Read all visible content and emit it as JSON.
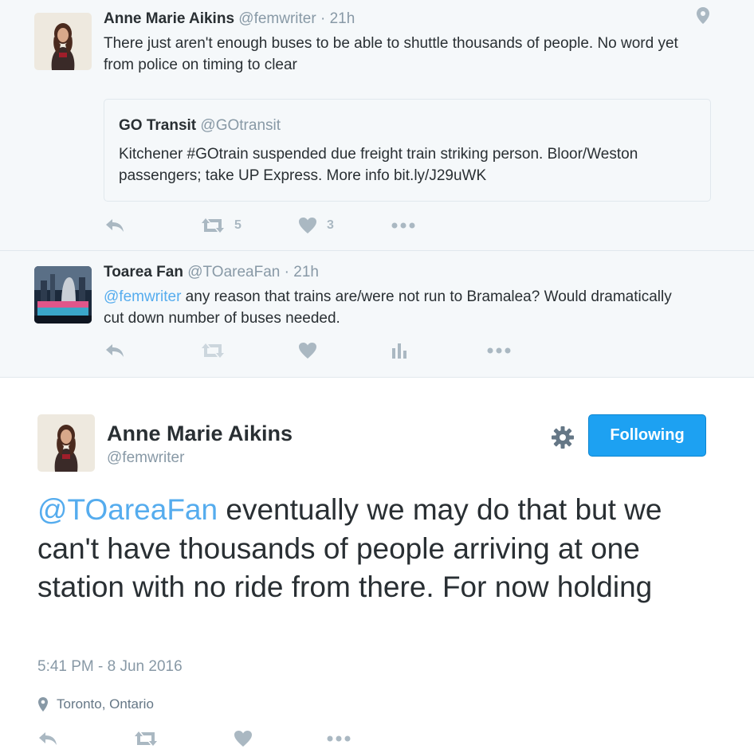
{
  "tweet1": {
    "name": "Anne Marie Aikins",
    "handle": "@femwriter",
    "time": "· 21h",
    "text": "There just aren't enough buses to be able to shuttle thousands of people. No word yet from police on timing to clear",
    "quote": {
      "name": "GO Transit",
      "handle": "@GOtransit",
      "text": "Kitchener #GOtrain suspended due freight train striking person. Bloor/Weston passengers; take UP Express. More info bit.ly/J29uWK"
    },
    "retweets": "5",
    "likes": "3"
  },
  "tweet2": {
    "name": "Toarea Fan",
    "handle": "@TOareaFan",
    "time": "· 21h",
    "mention": "@femwriter",
    "text": " any reason that trains are/were not run to Bramalea?  Would dramatically cut down number of buses needed."
  },
  "main": {
    "name": "Anne Marie Aikins",
    "handle": "@femwriter",
    "follow_label": "Following",
    "mention": "@TOareaFan",
    "text": " eventually we may do that but we can't have thousands of people arriving at one station with no ride from there. For now holding",
    "timestamp": "5:41 PM - 8 Jun 2016",
    "location": "Toronto, Ontario"
  },
  "colors": {
    "link": "#55acee",
    "follow_button": "#1da1f2",
    "icon_gray": "#aab8c2"
  }
}
